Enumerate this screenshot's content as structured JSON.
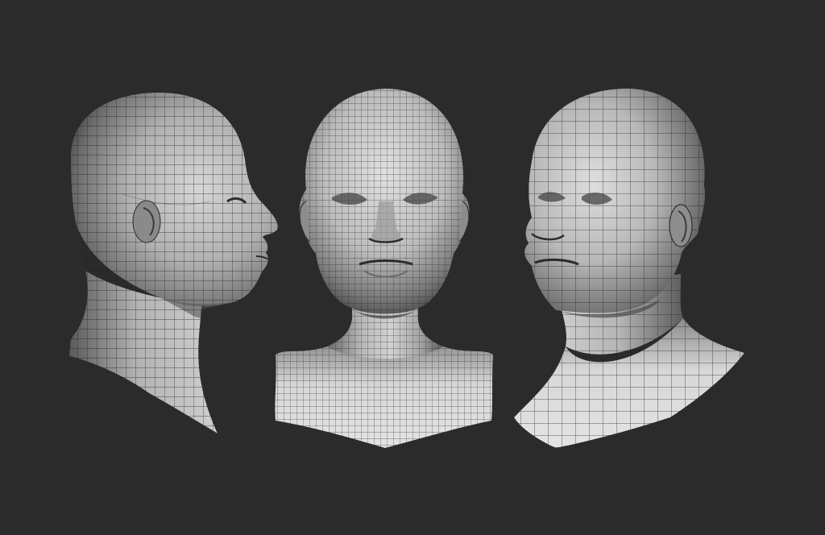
{
  "scene": {
    "background_color": "#2b2b2b",
    "mesh_light_color": "#d8d8d8",
    "mesh_mid_color": "#9c9c9c",
    "mesh_shadow_color": "#3c3c3c",
    "wireframe_color": "#1f1f1f",
    "views": [
      {
        "name": "profile-view",
        "orientation": "side"
      },
      {
        "name": "front-view",
        "orientation": "front"
      },
      {
        "name": "three-quarter-view",
        "orientation": "three-quarter"
      }
    ]
  }
}
